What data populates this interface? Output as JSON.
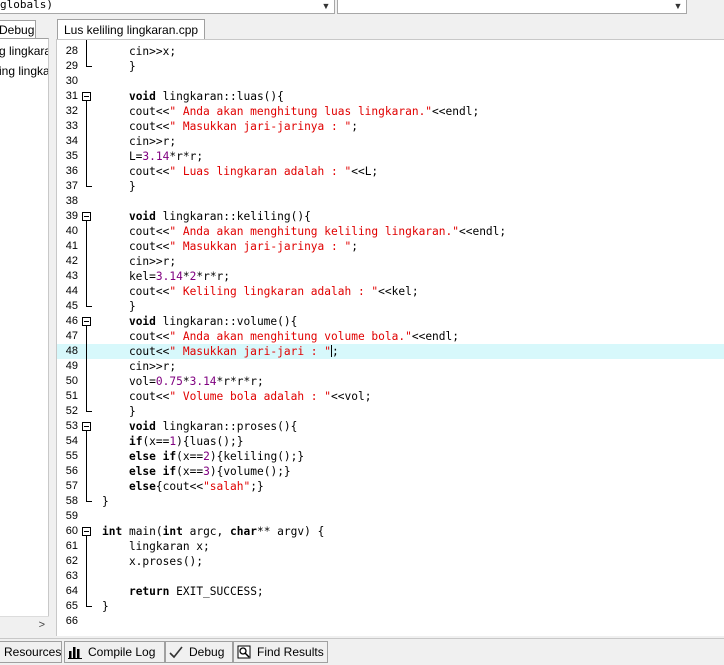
{
  "toolbar": {
    "scope_combo_value": "globals)",
    "member_combo_value": ""
  },
  "left_panel": {
    "tab_label": "Debug",
    "items": [
      "g lingkara",
      "ing lingka"
    ]
  },
  "editor": {
    "file_tab_label": "Lus keliling lingkaran.cpp",
    "current_line": 48,
    "lines": [
      {
        "n": "28",
        "t": "    cin>>x;"
      },
      {
        "n": "29",
        "t": "    }"
      },
      {
        "n": "30",
        "t": ""
      },
      {
        "n": "31",
        "t": "    void lingkaran::luas(){"
      },
      {
        "n": "32",
        "t": "    cout<<\" Anda akan menghitung luas lingkaran.\"<<endl;"
      },
      {
        "n": "33",
        "t": "    cout<<\" Masukkan jari-jarinya : \";"
      },
      {
        "n": "34",
        "t": "    cin>>r;"
      },
      {
        "n": "35",
        "t": "    L=3.14*r*r;"
      },
      {
        "n": "36",
        "t": "    cout<<\" Luas lingkaran adalah : \"<<L;"
      },
      {
        "n": "37",
        "t": "    }"
      },
      {
        "n": "38",
        "t": ""
      },
      {
        "n": "39",
        "t": "    void lingkaran::keliling(){"
      },
      {
        "n": "40",
        "t": "    cout<<\" Anda akan menghitung keliling lingkaran.\"<<endl;"
      },
      {
        "n": "41",
        "t": "    cout<<\" Masukkan jari-jarinya : \";"
      },
      {
        "n": "42",
        "t": "    cin>>r;"
      },
      {
        "n": "43",
        "t": "    kel=3.14*2*r*r;"
      },
      {
        "n": "44",
        "t": "    cout<<\" Keliling lingkaran adalah : \"<<kel;"
      },
      {
        "n": "45",
        "t": "    }"
      },
      {
        "n": "46",
        "t": "    void lingkaran::volume(){"
      },
      {
        "n": "47",
        "t": "    cout<<\" Anda akan menghitung volume bola.\"<<endl;"
      },
      {
        "n": "48",
        "t": "    cout<<\" Masukkan jari-jari : \";"
      },
      {
        "n": "49",
        "t": "    cin>>r;"
      },
      {
        "n": "50",
        "t": "    vol=0.75*3.14*r*r*r;"
      },
      {
        "n": "51",
        "t": "    cout<<\" Volume bola adalah : \"<<vol;"
      },
      {
        "n": "52",
        "t": "    }"
      },
      {
        "n": "53",
        "t": "    void lingkaran::proses(){"
      },
      {
        "n": "54",
        "t": "    if(x==1){luas();}"
      },
      {
        "n": "55",
        "t": "    else if(x==2){keliling();}"
      },
      {
        "n": "56",
        "t": "    else if(x==3){volume();}"
      },
      {
        "n": "57",
        "t": "    else{cout<<\"salah\";}"
      },
      {
        "n": "58",
        "t": "}"
      },
      {
        "n": "59",
        "t": ""
      },
      {
        "n": "60",
        "t": "int main(int argc, char** argv) {"
      },
      {
        "n": "61",
        "t": "    lingkaran x;"
      },
      {
        "n": "62",
        "t": "    x.proses();"
      },
      {
        "n": "63",
        "t": ""
      },
      {
        "n": "64",
        "t": "    return EXIT_SUCCESS;"
      },
      {
        "n": "65",
        "t": "}"
      },
      {
        "n": "66",
        "t": ""
      }
    ]
  },
  "bottom_tabs": [
    {
      "label": "Resources",
      "icon": "resources-icon"
    },
    {
      "label": "Compile Log",
      "icon": "chart-bars-icon"
    },
    {
      "label": "Debug",
      "icon": "check-icon"
    },
    {
      "label": "Find Results",
      "icon": "find-icon"
    }
  ],
  "colors": {
    "string": "#e00000",
    "number": "#800080",
    "current_line_bg": "#d7f8fb"
  }
}
